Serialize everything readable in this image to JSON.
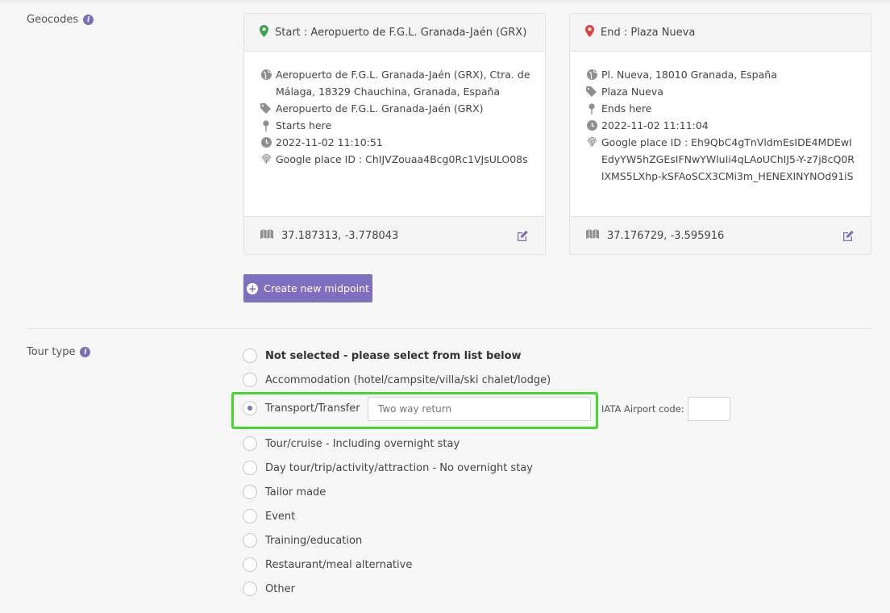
{
  "geocodes": {
    "label": "Geocodes",
    "start": {
      "header": "Start : Aeropuerto de F.G.L. Granada-Jaén (GRX)",
      "address": "Aeropuerto de F.G.L. Granada-Jaén (GRX), Ctra. de Málaga, 18329 Chauchina, Granada, España",
      "name": "Aeropuerto de F.G.L. Granada-Jaén (GRX)",
      "role": "Starts here",
      "timestamp": "2022-11-02 11:10:51",
      "place_id": "Google place ID : ChIJVZouaa4Bcg0Rc1VJsULO08s",
      "coords": "37.187313, -3.778043",
      "marker_color": "#3aa34a"
    },
    "end": {
      "header": "End : Plaza Nueva",
      "address": "Pl. Nueva, 18010 Granada, España",
      "name": "Plaza Nueva",
      "role": "Ends here",
      "timestamp": "2022-11-02 11:11:04",
      "place_id": "Google place ID : Eh9QbC4gTnVldmEsIDE4MDEwIEdyYW5hZGEsIFNwYWluIi4qLAoUChIJ5-Y-z7j8cQ0RlXMS5LXhp-kSFAoSCX3CMi3m_HENEXINYNOd91iS",
      "coords": "37.176729, -3.595916",
      "marker_color": "#e0413c"
    },
    "create_midpoint_label": "Create new midpoint"
  },
  "tour_type": {
    "label": "Tour type",
    "options": [
      "Not selected - please select from list below",
      "Accommodation (hotel/campsite/villa/ski chalet/lodge)",
      "Transport/Transfer",
      "Tour/cruise - Including overnight stay",
      "Day tour/trip/activity/attraction - No overnight stay",
      "Tailor made",
      "Event",
      "Training/education",
      "Restaurant/meal alternative",
      "Other"
    ],
    "selected": "Transport/Transfer",
    "transfer_input": {
      "placeholder": "Two way return",
      "value": ""
    },
    "iata_label": "IATA Airport code:",
    "iata_value": ""
  },
  "colors": {
    "accent": "#7f6fc0",
    "highlight": "#46d62c"
  }
}
